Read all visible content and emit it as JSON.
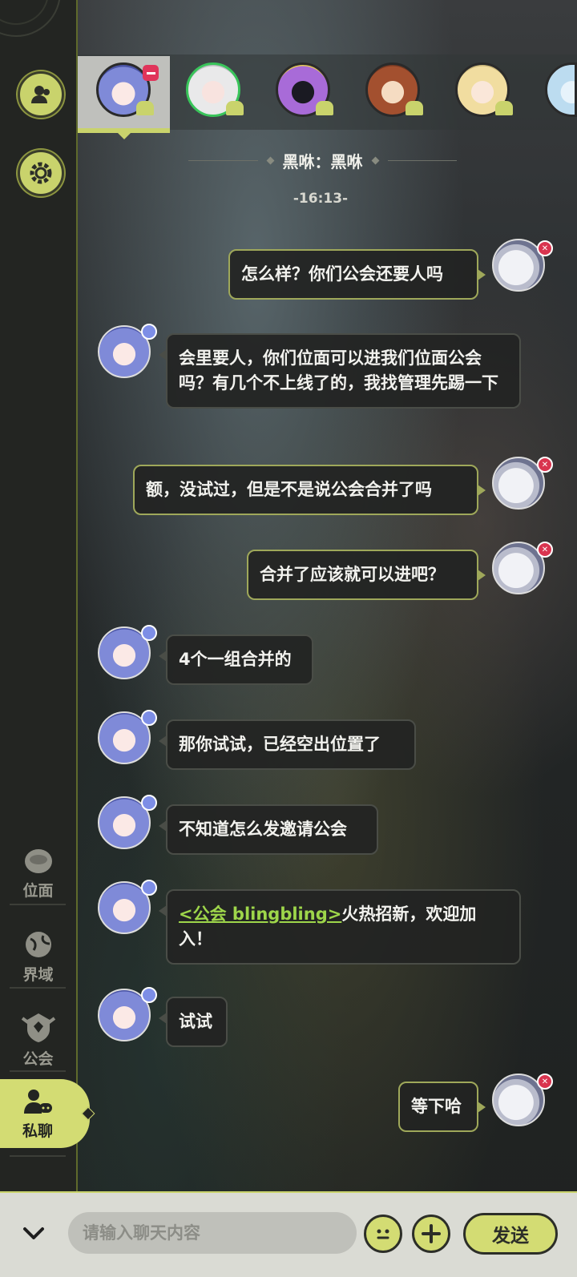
{
  "sidebar": {
    "nav": [
      {
        "label": "位面",
        "icon": "coin-icon"
      },
      {
        "label": "界域",
        "icon": "globe-icon"
      },
      {
        "label": "公会",
        "icon": "guild-crest-icon"
      },
      {
        "label": "私聊",
        "icon": "private-chat-icon",
        "active": true
      }
    ]
  },
  "chat": {
    "header": "黑咻：黑咻",
    "time": "-16:13-",
    "messages": [
      {
        "from": "me",
        "text": "怎么样？你们公会还要人吗"
      },
      {
        "from": "other",
        "text": "会里要人，你们位面可以进我们位面公会吗？有几个不上线了的，我找管理先踢一下"
      },
      {
        "from": "me",
        "text": "额，没试过，但是不是说公会合并了吗"
      },
      {
        "from": "me",
        "text": "合并了应该就可以进吧？"
      },
      {
        "from": "other",
        "text": "4个一组合并的"
      },
      {
        "from": "other",
        "text": "那你试试，已经空出位置了"
      },
      {
        "from": "other",
        "text": "不知道怎么发邀请公会"
      },
      {
        "from": "other",
        "link": "<公会 blingbling>",
        "text": "火热招新，欢迎加入！"
      },
      {
        "from": "other",
        "text": "试试"
      },
      {
        "from": "me",
        "text": "等下哈"
      }
    ]
  },
  "input": {
    "placeholder": "请输入聊天内容",
    "send_label": "发送"
  },
  "colors": {
    "accent": "#d3dc73",
    "remove_badge": "#e0345a"
  }
}
